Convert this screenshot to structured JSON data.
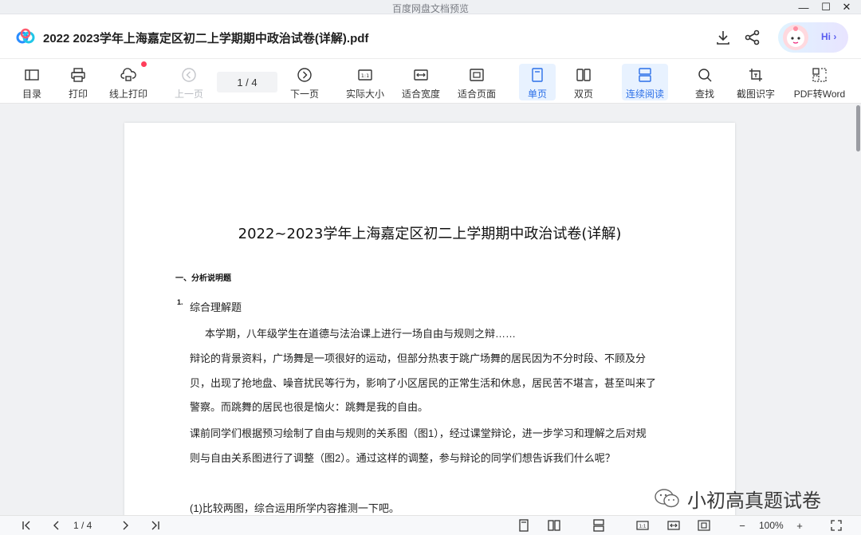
{
  "os": {
    "title": "百度网盘文档预览",
    "min": "—",
    "max": "☐",
    "close": "✕"
  },
  "header": {
    "logo_icon": "baidu-netdisk-logo",
    "doc_title": "2022  2023学年上海嘉定区初二上学期期中政治试卷(详解).pdf",
    "download_icon": "download-icon",
    "share_icon": "share-icon",
    "assistant_label": "Hi ›"
  },
  "toolbar": {
    "toc": "目录",
    "print": "打印",
    "online_print": "线上打印",
    "prev": "上一页",
    "page_indicator": "1  /  4",
    "next": "下一页",
    "actual_size": "实际大小",
    "fit_width": "适合宽度",
    "fit_page": "适合页面",
    "single_page": "单页",
    "double_page": "双页",
    "continuous": "连续阅读",
    "find": "查找",
    "ocr": "截图识字",
    "pdf_to_word": "PDF转Word"
  },
  "document": {
    "title": "2022~2023学年上海嘉定区初二上学期期中政治试卷(详解)",
    "section": "一、分析说明题",
    "q_number": "1.",
    "q_title": "综合理解题",
    "lines": [
      "本学期，八年级学生在道德与法治课上进行一场自由与规则之辩……",
      "辩论的背景资料，广场舞是一项很好的运动，但部分热衷于跳广场舞的居民因为不分时段、不顾及分",
      "贝，出现了抢地盘、噪音扰民等行为，影响了小区居民的正常生活和休息，居民苦不堪言，甚至叫来了",
      "警察。而跳舞的居民也很是恼火：跳舞是我的自由。",
      "课前同学们根据预习绘制了自由与规则的关系图（图1），经过课堂辩论，进一步学习和理解之后对规",
      "则与自由关系图进行了调整（图2）。通过这样的调整，参与辩论的同学们想告诉我们什么呢？",
      "(1)比较两图，综合运用所学内容推测一下吧。"
    ]
  },
  "watermark": {
    "text": "小初高真题试卷"
  },
  "bottom": {
    "page_indicator": "1  /  4",
    "zoom": "100%",
    "zoom_out": "−",
    "zoom_in": "+"
  }
}
